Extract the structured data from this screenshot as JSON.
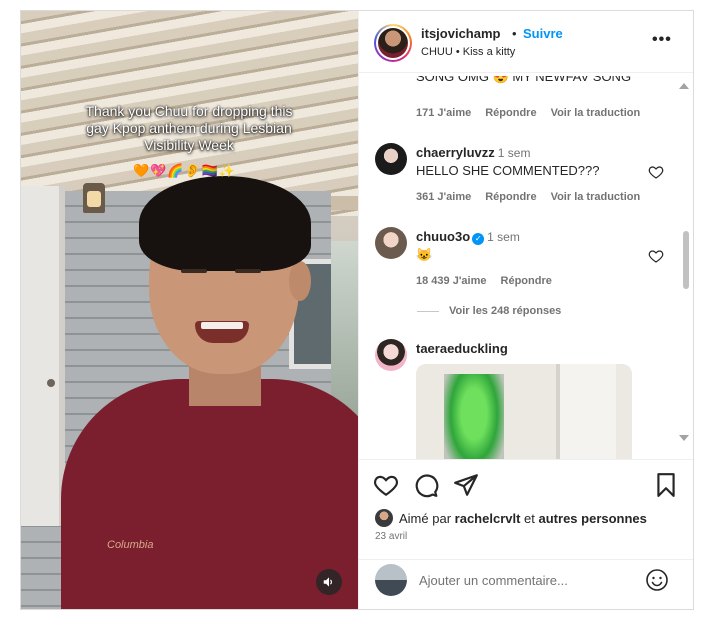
{
  "post": {
    "username": "itsjovichamp",
    "separator": "•",
    "follow_label": "Suivre",
    "music": "CHUU • Kiss a kitty",
    "more_icon": "more-horizontal-icon"
  },
  "video": {
    "caption": "Thank you Chuu for dropping this gay Kpop anthem during Lesbian Visibility Week",
    "caption_emoji": "🧡💖🌈👂🏳️‍🌈✨",
    "shirt_logo": "Columbia",
    "sound_icon": "speaker-icon"
  },
  "comments": [
    {
      "username": "",
      "text": "SONG OMG 😍 MY NEWFAV SONG",
      "likes": "171 J'aime",
      "reply": "Répondre",
      "translate": "Voir la traduction"
    },
    {
      "username": "chaerryluvzz",
      "time": "1 sem",
      "text": "HELLO SHE COMMENTED???",
      "likes": "361 J'aime",
      "reply": "Répondre",
      "translate": "Voir la traduction"
    },
    {
      "username": "chuuo3o",
      "verified": true,
      "time": "1 sem",
      "text": "😺",
      "likes": "18 439 J'aime",
      "reply": "Répondre",
      "view_replies": "Voir les 248 réponses"
    },
    {
      "username": "taeraeduckling",
      "has_gif": true
    }
  ],
  "actions": {
    "liked_prefix": "Aimé par",
    "liked_user": "rachelcrvlt",
    "liked_and": "et",
    "liked_others": "autres personnes",
    "date": "23 avril"
  },
  "comment_box": {
    "placeholder": "Ajouter un commentaire..."
  },
  "colors": {
    "accent": "#0095f6",
    "text": "#262626",
    "muted": "#737373",
    "border": "#dbdbdb"
  }
}
